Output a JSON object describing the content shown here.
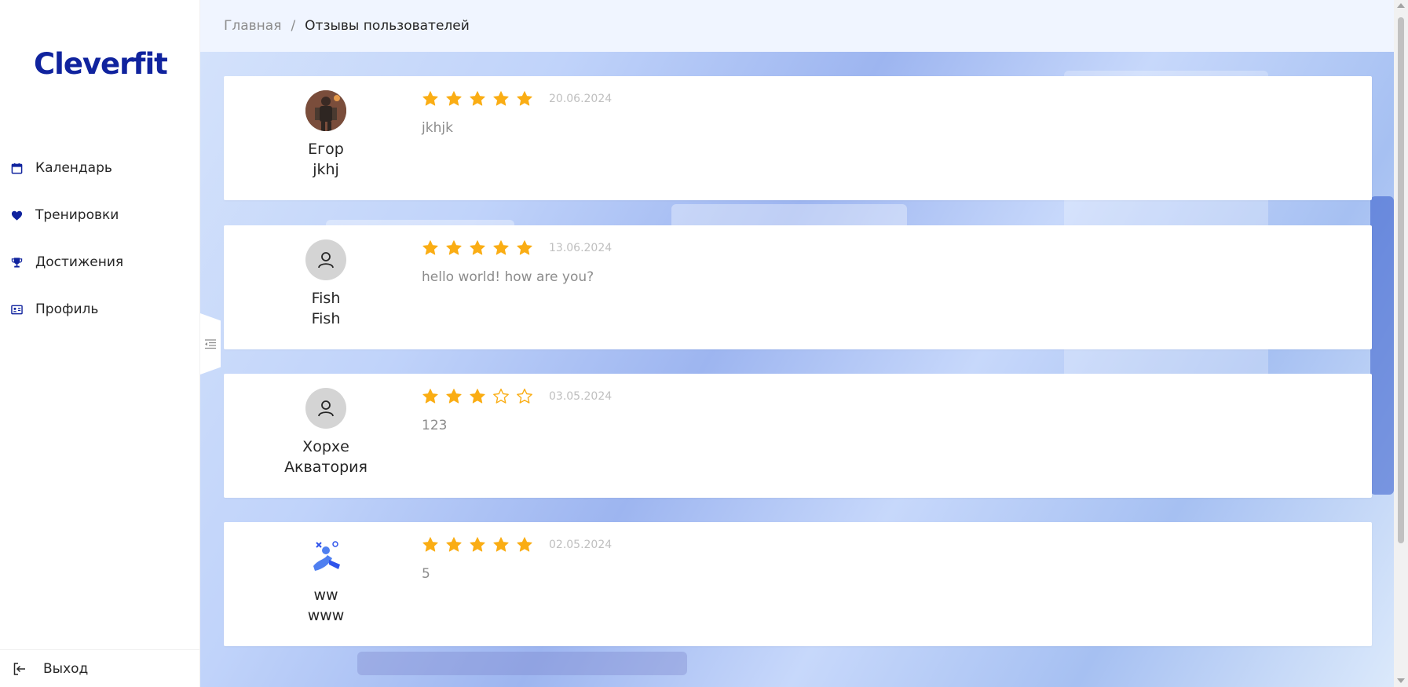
{
  "app": {
    "logo": "Cleverfit"
  },
  "sidebar": {
    "items": [
      {
        "label": "Календарь",
        "icon": "calendar-icon"
      },
      {
        "label": "Тренировки",
        "icon": "heart-icon"
      },
      {
        "label": "Достижения",
        "icon": "trophy-icon"
      },
      {
        "label": "Профиль",
        "icon": "idcard-icon"
      }
    ],
    "logout_label": "Выход",
    "collapse_icon": "menu-fold-icon"
  },
  "breadcrumb": {
    "home": "Главная",
    "separator": "/",
    "current": "Отзывы пользователей"
  },
  "colors": {
    "brand": "#10239e",
    "star": "#faad14",
    "accent": "#2f54eb"
  },
  "reviews": [
    {
      "first_name": "Егор",
      "last_name": "jkhj",
      "rating": 5,
      "date": "20.06.2024",
      "text": "jkhjk",
      "avatar": "photo-avatar"
    },
    {
      "first_name": "Fish",
      "last_name": "Fish",
      "rating": 5,
      "date": "13.06.2024",
      "text": "hello world! how are you?",
      "avatar": "user-icon"
    },
    {
      "first_name": "Хорхе",
      "last_name": "Акватория",
      "rating": 3,
      "date": "03.05.2024",
      "text": "123",
      "avatar": "user-icon"
    },
    {
      "first_name": "ww",
      "last_name": "www",
      "rating": 5,
      "date": "02.05.2024",
      "text": "5",
      "avatar": "illustration-avatar"
    }
  ]
}
